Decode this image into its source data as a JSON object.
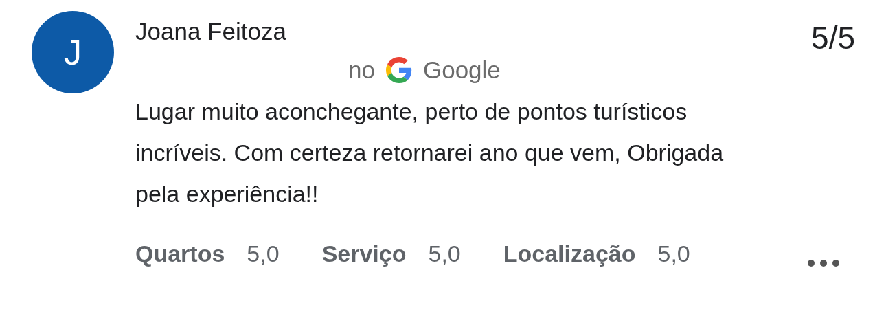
{
  "reviewer": {
    "initial": "J",
    "name": "Joana Feitoza"
  },
  "score": "5/5",
  "source": {
    "prefix": "no",
    "name": "Google"
  },
  "review": "Lugar muito aconchegante, perto de pontos turísticos incríveis. Com certeza retornarei ano que vem, Obrigada pela experiência!!",
  "ratings": [
    {
      "label": "Quartos",
      "value": "5,0"
    },
    {
      "label": "Serviço",
      "value": "5,0"
    },
    {
      "label": "Localização",
      "value": "5,0"
    }
  ]
}
